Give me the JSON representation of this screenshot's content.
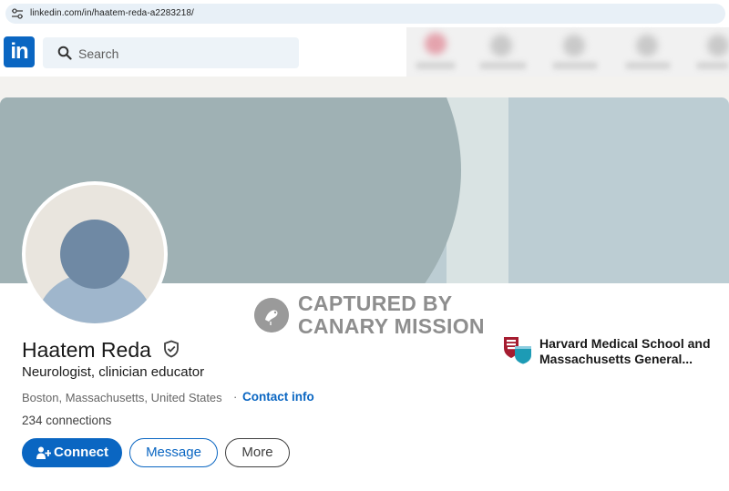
{
  "browser": {
    "url": "linkedin.com/in/haatem-reda-a2283218/"
  },
  "nav": {
    "logo_text": "in",
    "search_placeholder": "Search"
  },
  "profile": {
    "name": "Haatem Reda",
    "headline": "Neurologist, clinician educator",
    "location": "Boston, Massachusetts, United States",
    "separator": "·",
    "contact_label": "Contact info",
    "connections": "234 connections",
    "organization": "Harvard Medical School and Massachusetts General..."
  },
  "actions": {
    "connect_label": "Connect",
    "message_label": "Message",
    "more_label": "More"
  },
  "watermark": {
    "line1": "CAPTURED BY",
    "line2": "CANARY MISSION"
  },
  "colors": {
    "linkedin_blue": "#0a66c2",
    "banner_dark": "#9fb1b4",
    "banner_light": "#bccdd3"
  },
  "icons": {
    "site_settings": "site-settings-icon",
    "search": "search-icon",
    "verified": "verified-shield-icon",
    "connect": "add-person-icon",
    "org_logo": "harvard-mgh-logo-icon"
  }
}
